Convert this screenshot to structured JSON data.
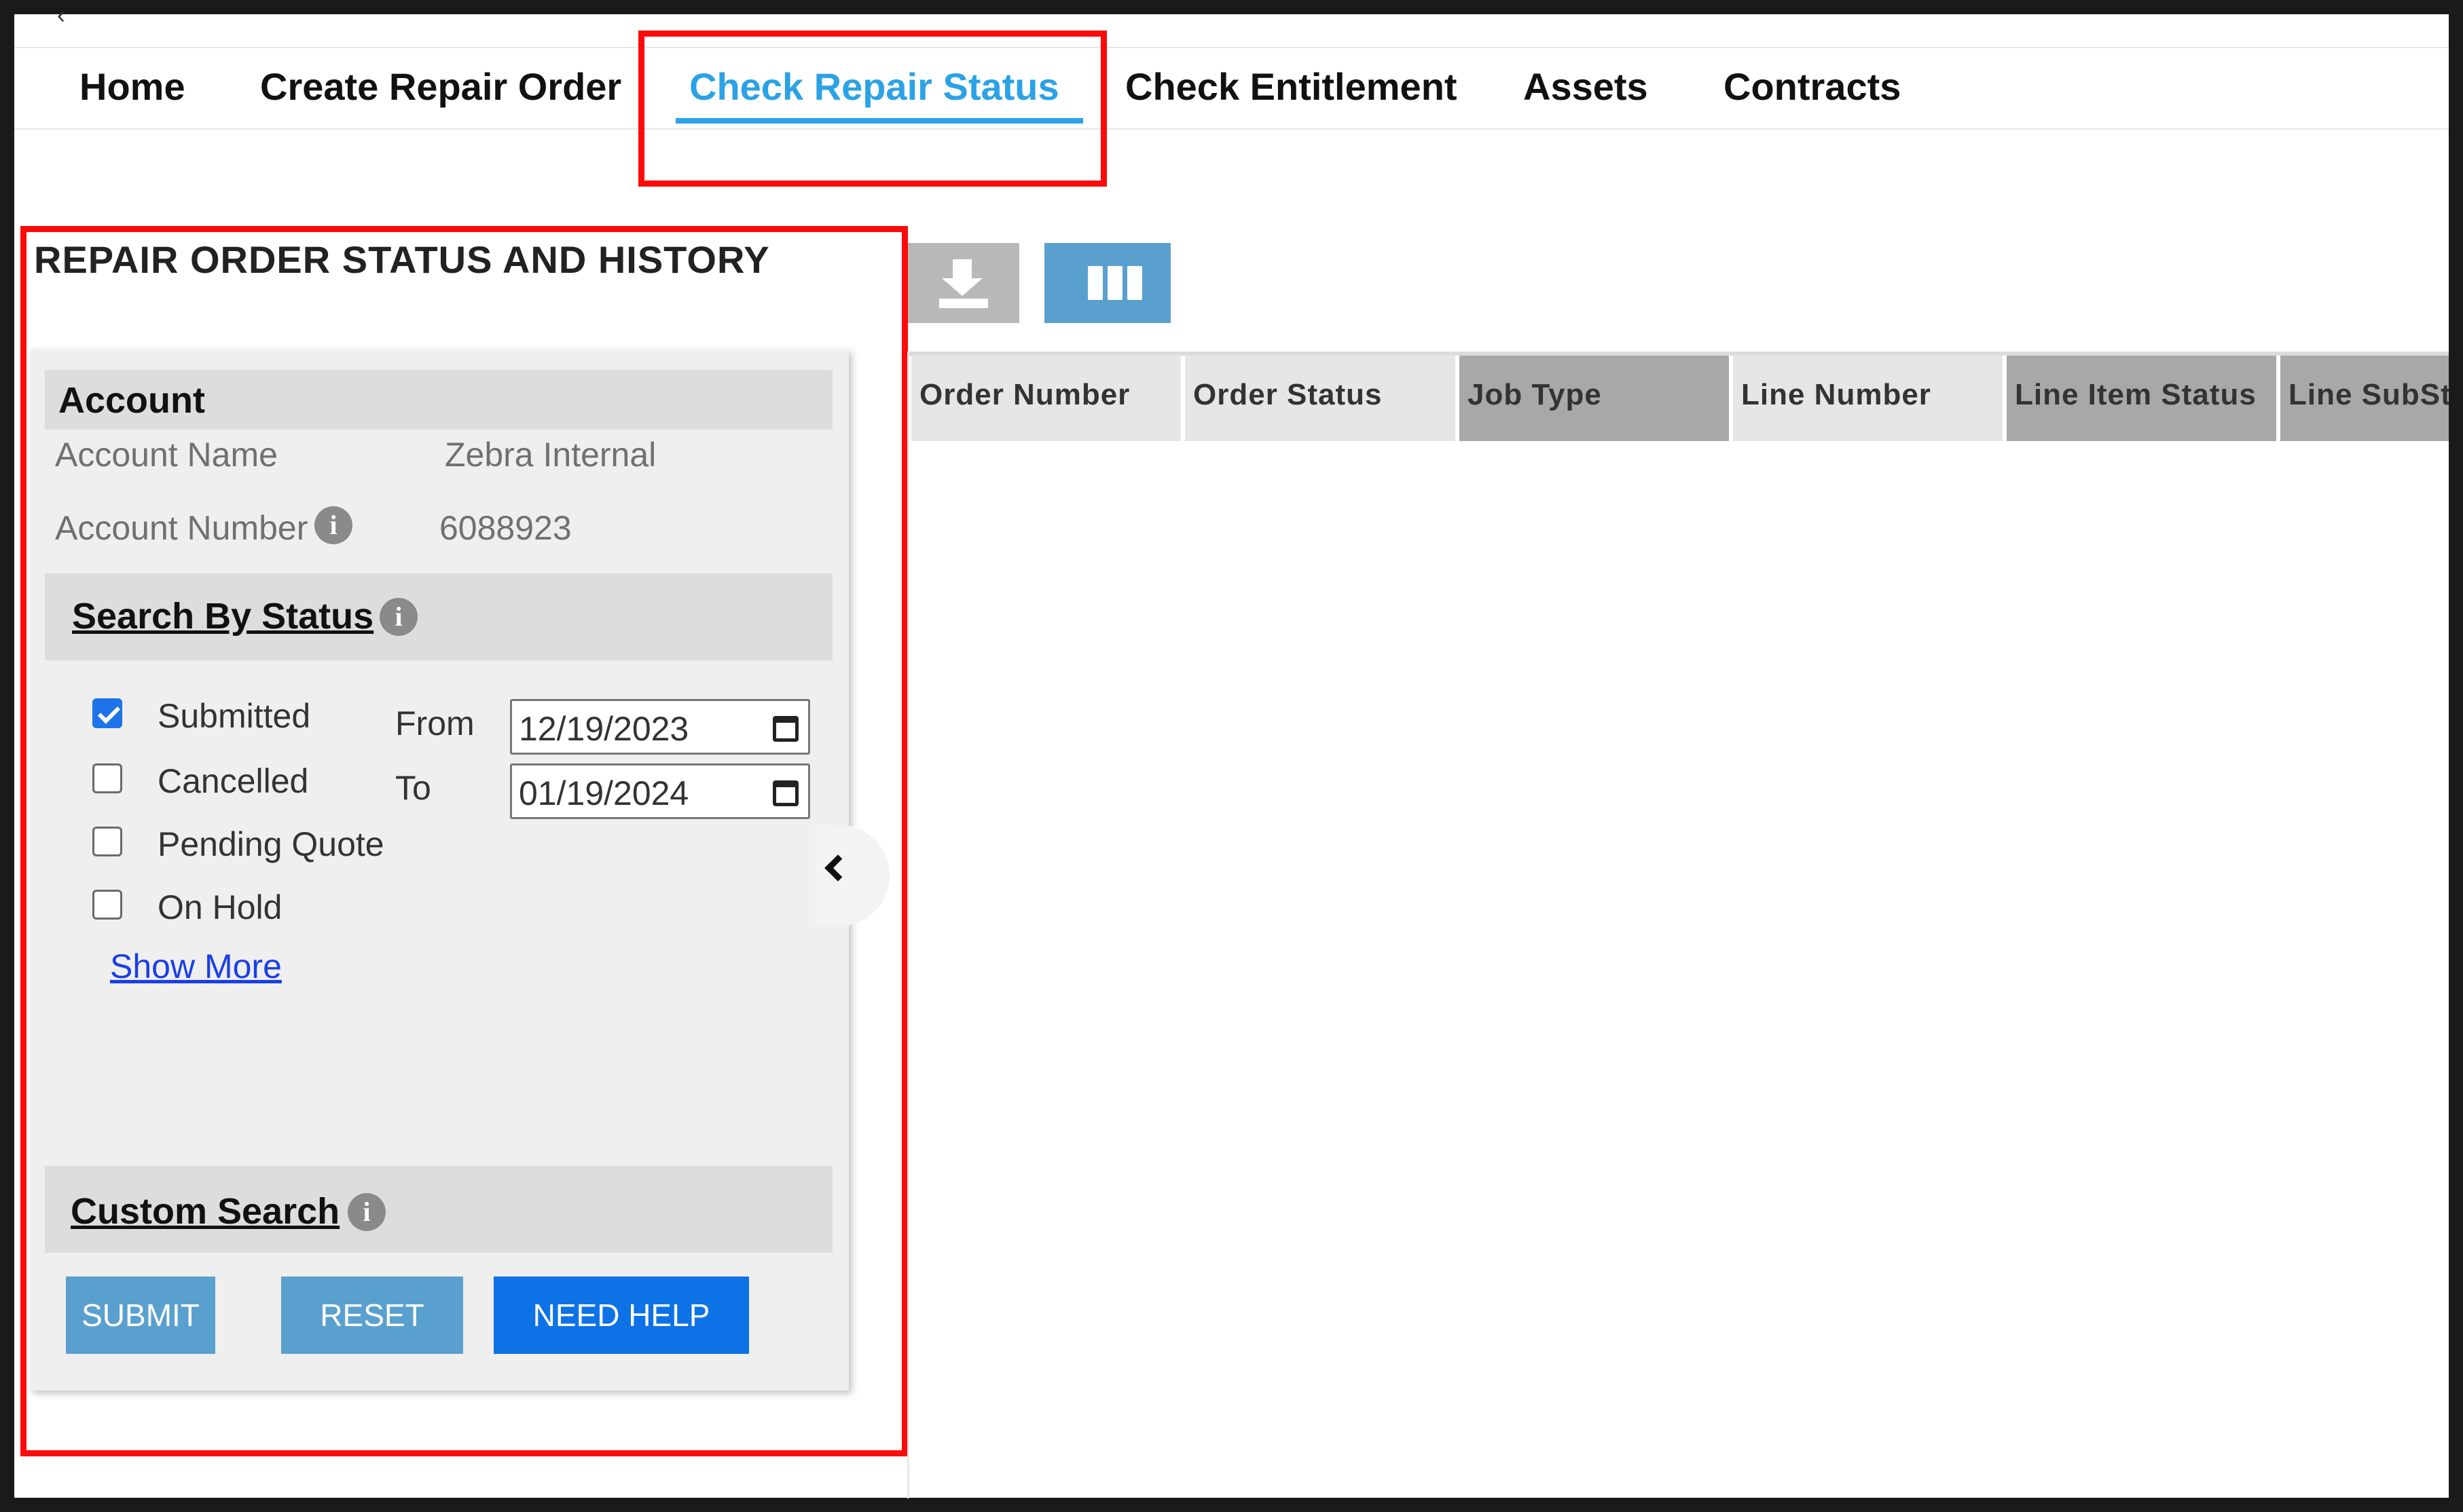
{
  "nav": {
    "items": [
      {
        "label": "Home"
      },
      {
        "label": "Create Repair Order"
      },
      {
        "label": "Check Repair Status"
      },
      {
        "label": "Check Entitlement"
      },
      {
        "label": "Assets"
      },
      {
        "label": "Contracts"
      }
    ],
    "active_index": 2,
    "active_color": "#2ca2e6"
  },
  "panel": {
    "title": "REPAIR ORDER STATUS AND HISTORY",
    "account": {
      "header": "Account",
      "name_label": "Account Name",
      "name_value": "Zebra Internal",
      "number_label": "Account Number",
      "number_value": "6088923"
    },
    "status_search": {
      "header": "Search By Status",
      "options": [
        {
          "label": "Submitted",
          "checked": true
        },
        {
          "label": "Cancelled",
          "checked": false
        },
        {
          "label": "Pending Quote",
          "checked": false
        },
        {
          "label": "On Hold",
          "checked": false
        }
      ],
      "from_label": "From",
      "from_value": "12/19/2023",
      "to_label": "To",
      "to_value": "01/19/2024",
      "show_more": "Show More"
    },
    "custom_search": {
      "header": "Custom Search"
    },
    "buttons": {
      "submit": "SUBMIT",
      "reset": "RESET",
      "help": "NEED HELP"
    }
  },
  "toolbar": {
    "download_icon": "download-icon",
    "columns_icon": "columns-icon"
  },
  "grid": {
    "columns": [
      {
        "label": "Order Number"
      },
      {
        "label": "Order Status"
      },
      {
        "label": "Job Type"
      },
      {
        "label": "Line Number"
      },
      {
        "label": "Line Item Status"
      },
      {
        "label": "Line SubSta"
      }
    ]
  },
  "colors": {
    "highlight": "#ff0a0a",
    "button_blue": "#5aa0cf",
    "help_blue": "#0d72e6",
    "checkbox_blue": "#1d73e8",
    "link_blue": "#1a3ee8"
  }
}
